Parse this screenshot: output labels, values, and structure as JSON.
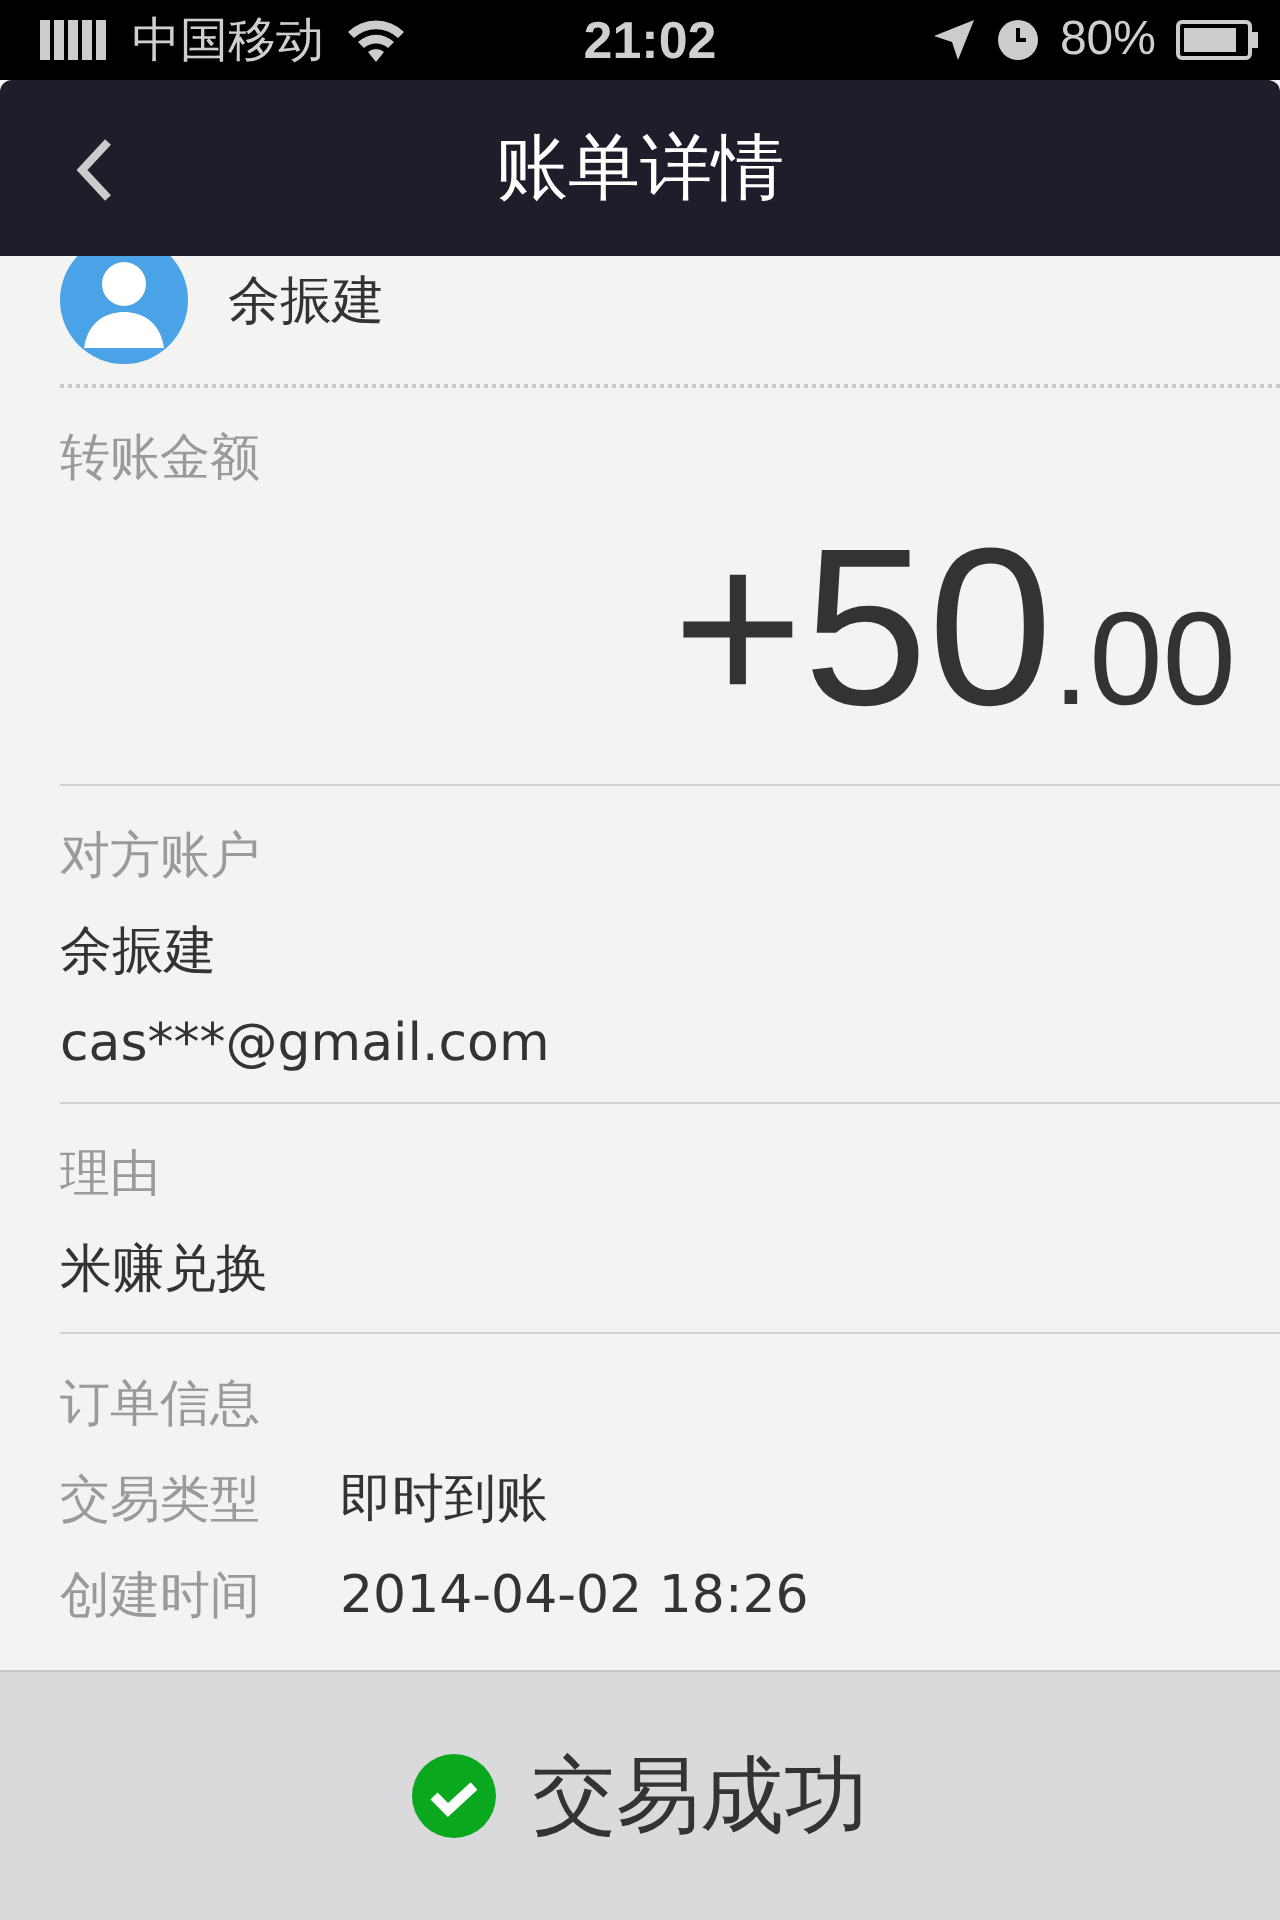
{
  "status_bar": {
    "carrier": "中国移动",
    "time": "21:02",
    "battery": "80%"
  },
  "nav": {
    "title": "账单详情"
  },
  "payer": {
    "name": "余振建"
  },
  "amount": {
    "label": "转账金额",
    "integer": "+50",
    "decimal": ".00"
  },
  "counterparty": {
    "label": "对方账户",
    "name": "余振建",
    "email": "cas***@gmail.com"
  },
  "reason": {
    "label": "理由",
    "text": "米赚兑换"
  },
  "order": {
    "label": "订单信息",
    "rows": [
      {
        "key": "交易类型",
        "value": "即时到账"
      },
      {
        "key": "创建时间",
        "value": "2014-04-02 18:26"
      }
    ]
  },
  "footer": {
    "status": "交易成功"
  }
}
